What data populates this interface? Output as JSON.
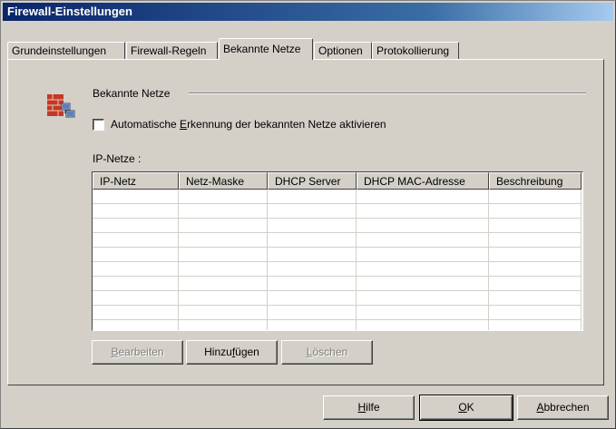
{
  "window": {
    "title": "Firewall-Einstellungen"
  },
  "tabs": [
    {
      "label": "Grundeinstellungen",
      "active": false
    },
    {
      "label": "Firewall-Regeln",
      "active": false
    },
    {
      "label": "Bekannte Netze",
      "active": true
    },
    {
      "label": "Optionen",
      "active": false
    },
    {
      "label": "Protokollierung",
      "active": false
    }
  ],
  "section": {
    "title": "Bekannte Netze",
    "icon": "firewall-network-icon"
  },
  "auto_detect": {
    "label_pre": "Automatische ",
    "label_mn": "E",
    "label_post": "rkennung der bekannten Netze aktivieren",
    "checked": false
  },
  "ip_networks": {
    "label": "IP-Netze :",
    "columns": [
      "IP-Netz",
      "Netz-Maske",
      "DHCP Server",
      "DHCP MAC-Adresse",
      "Beschreibung"
    ],
    "rows": []
  },
  "table_buttons": {
    "edit_mn": "B",
    "edit_rest": "earbeiten",
    "add_pre": "Hinzu",
    "add_mn": "f",
    "add_post": "ügen",
    "delete_mn": "L",
    "delete_rest": "öschen"
  },
  "footer_buttons": {
    "help_mn": "H",
    "help_rest": "ilfe",
    "ok_mn": "O",
    "ok_rest": "K",
    "cancel_mn": "A",
    "cancel_rest": "bbrechen"
  }
}
